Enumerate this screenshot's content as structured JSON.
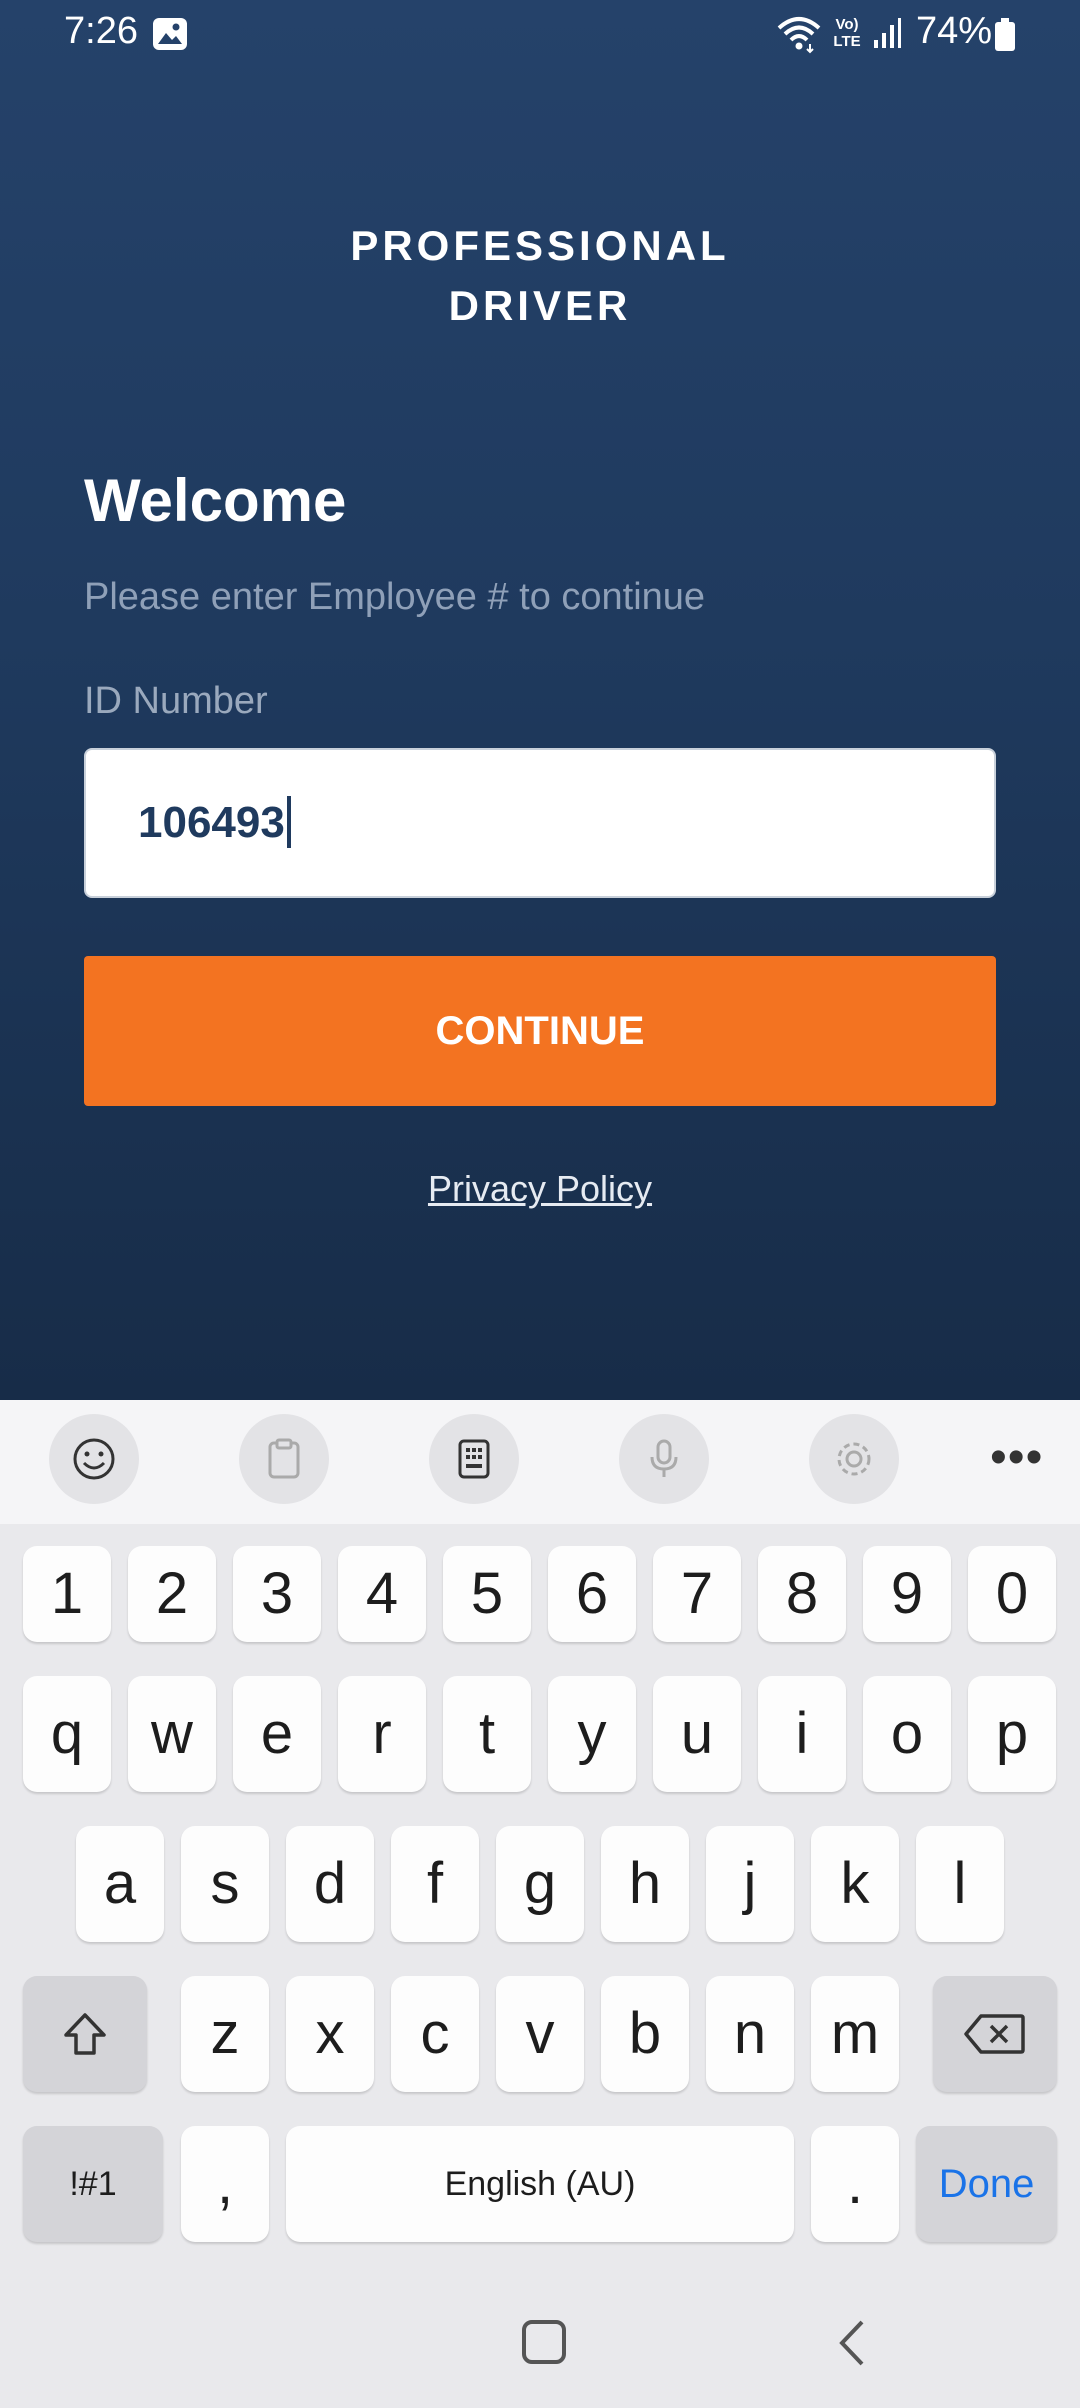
{
  "status_bar": {
    "time": "7:26",
    "battery": "74%",
    "network": "Vo) LTE"
  },
  "app": {
    "brand_line1": "PROFESSIONAL",
    "brand_line2": "DRIVER",
    "welcome": "Welcome",
    "subtitle": "Please enter Employee # to continue",
    "id_label": "ID Number",
    "id_value": "106493",
    "continue_label": "CONTINUE",
    "privacy_label": "Privacy Policy",
    "accent_color": "#f37321",
    "background_color": "#1f3a5e"
  },
  "keyboard": {
    "toolbar_icons": [
      "emoji-icon",
      "clipboard-icon",
      "keyboard-layout-icon",
      "microphone-icon",
      "settings-icon",
      "more-icon"
    ],
    "more": "•••",
    "row_numbers": [
      "1",
      "2",
      "3",
      "4",
      "5",
      "6",
      "7",
      "8",
      "9",
      "0"
    ],
    "row_1": [
      "q",
      "w",
      "e",
      "r",
      "t",
      "y",
      "u",
      "i",
      "o",
      "p"
    ],
    "row_2": [
      "a",
      "s",
      "d",
      "f",
      "g",
      "h",
      "j",
      "k",
      "l"
    ],
    "row_3": [
      "z",
      "x",
      "c",
      "v",
      "b",
      "n",
      "m"
    ],
    "symbols": "!#1",
    "comma": ",",
    "space": "English (AU)",
    "period": ".",
    "done": "Done"
  }
}
